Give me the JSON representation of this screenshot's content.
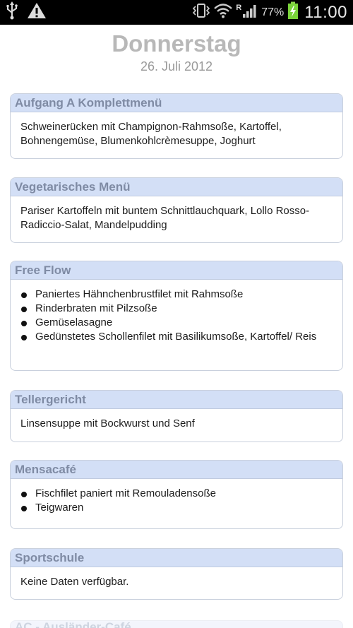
{
  "status_bar": {
    "battery_percent": "77%",
    "time": "11:00",
    "roaming_mark": "R",
    "icons": [
      "usb-icon",
      "warning-icon",
      "vibrate-icon",
      "wifi-icon",
      "signal-icon",
      "battery-icon"
    ]
  },
  "header": {
    "day": "Donnerstag",
    "date": "26. Juli 2012"
  },
  "sections": [
    {
      "title": "Aufgang A Komplettmenü",
      "text": "Schweinerücken mit Champignon-Rahmsoße, Kartoffel, Bohnengemüse, Blumenkohlcrèmesuppe, Joghurt"
    },
    {
      "title": "Vegetarisches Menü",
      "text": "Pariser Kartoffeln mit buntem Schnittlauchquark, Lollo Rosso-Radiccio-Salat, Mandelpudding"
    },
    {
      "title": "Free Flow",
      "items": [
        "Paniertes Hähnchenbrustfilet mit Rahmsoße",
        "Rinderbraten mit Pilzsoße",
        "Gemüselasagne",
        "Gedünstetes Schollenfilet mit Basilikumsoße, Kartoffel/ Reis"
      ]
    },
    {
      "title": "Tellergericht",
      "text": "Linsensuppe mit Bockwurst und Senf"
    },
    {
      "title": "Mensacafé",
      "items": [
        "Fischfilet paniert mit Remouladensoße",
        "Teigwaren"
      ]
    },
    {
      "title": "Sportschule",
      "text": "Keine Daten verfügbar."
    },
    {
      "title": "AC - Ausländer-Café"
    }
  ],
  "colors": {
    "status_bar_bg": "#000000",
    "card_header_bg": "#d3dff6",
    "card_header_text": "#7f8ba4",
    "card_border": "#c9d0dd",
    "title_gray": "#b8b8b8",
    "battery_green": "#7ad33a"
  }
}
